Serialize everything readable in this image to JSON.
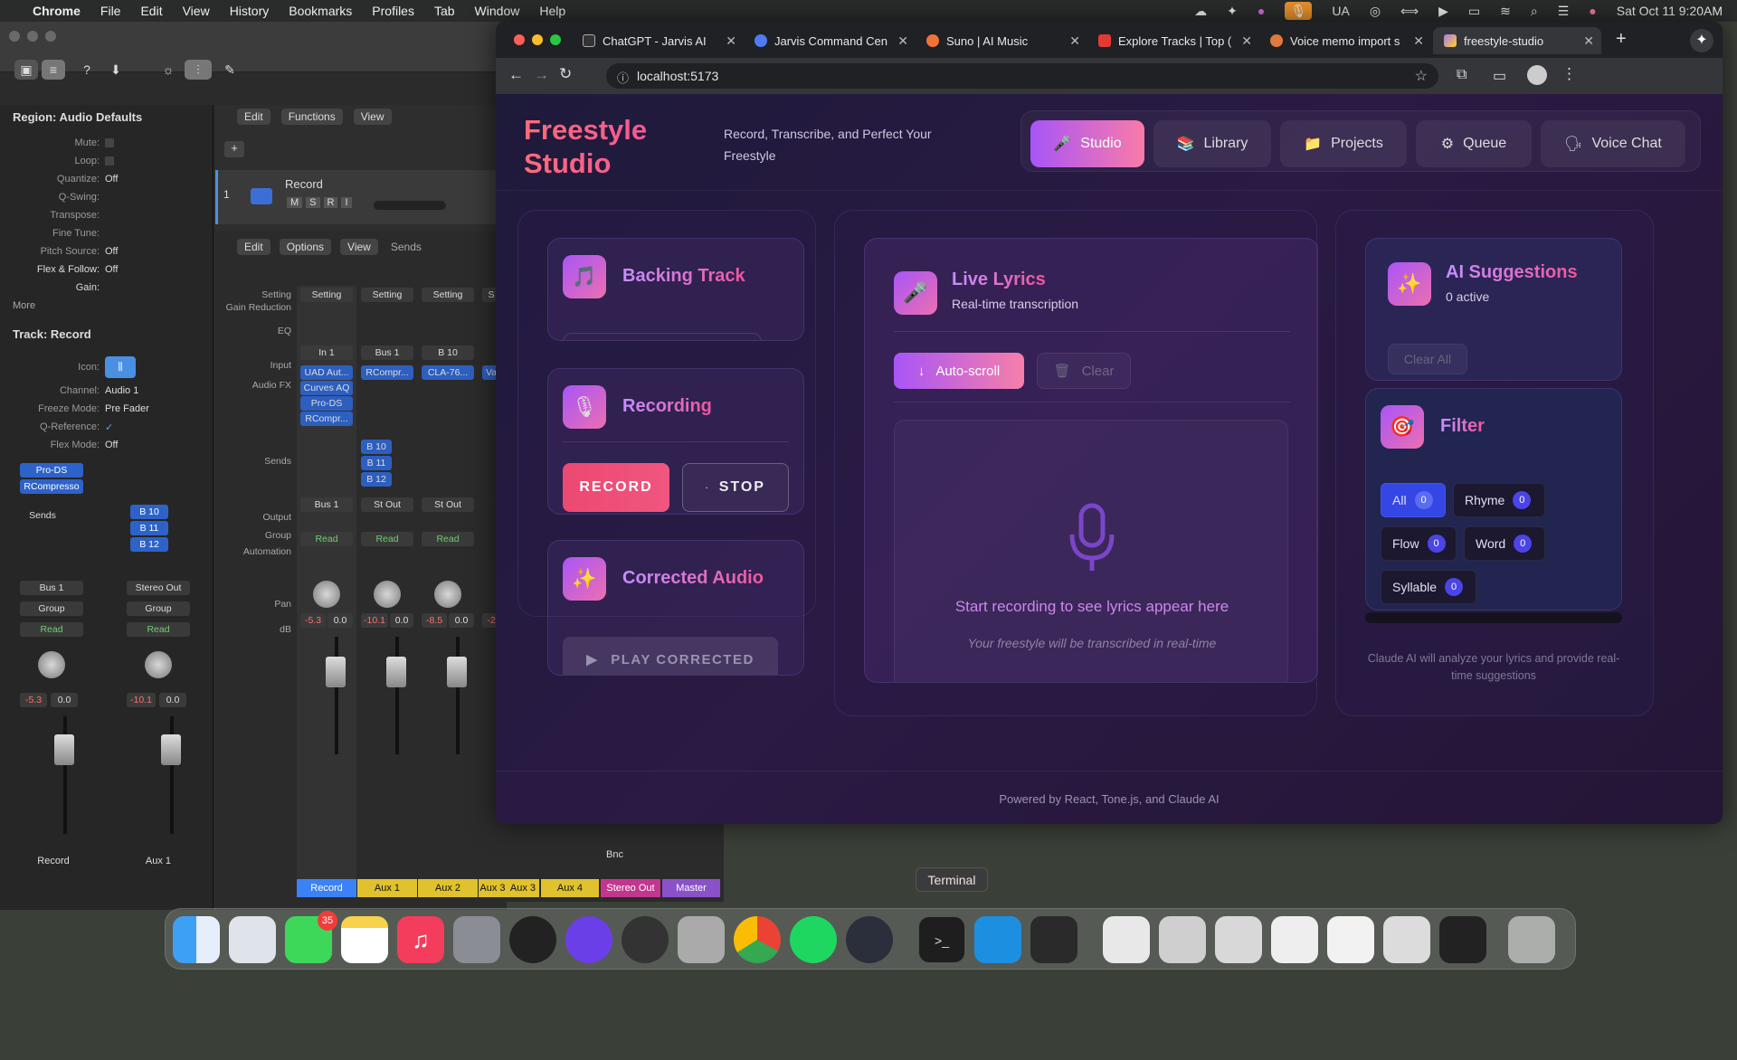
{
  "menubar": {
    "app": "Chrome",
    "items": [
      "File",
      "Edit",
      "View",
      "History",
      "Bookmarks",
      "Profiles",
      "Tab",
      "Window",
      "Help"
    ],
    "status_text": "UA",
    "datetime": "Sat Oct 11  9:20AM"
  },
  "logic": {
    "region_header": "Region: Audio Defaults",
    "region_rows": [
      {
        "k": "Mute:",
        "v": ""
      },
      {
        "k": "Loop:",
        "v": ""
      },
      {
        "k": "Quantize:",
        "v": "Off"
      },
      {
        "k": "Q-Swing:",
        "v": ""
      },
      {
        "k": "Transpose:",
        "v": ""
      },
      {
        "k": "Fine Tune:",
        "v": ""
      },
      {
        "k": "Pitch Source:",
        "v": "Off"
      },
      {
        "k": "Flex & Follow:",
        "v": "Off"
      },
      {
        "k": "Gain:",
        "v": ""
      }
    ],
    "more": "More",
    "track_header": "Track:  Record",
    "track_rows": [
      {
        "k": "Icon:",
        "v": ""
      },
      {
        "k": "Channel:",
        "v": "Audio 1"
      },
      {
        "k": "Freeze Mode:",
        "v": "Pre Fader"
      },
      {
        "k": "Q-Reference:",
        "v": "✓"
      },
      {
        "k": "Flex Mode:",
        "v": "Off"
      }
    ],
    "menus_top": [
      "Edit",
      "Functions",
      "View"
    ],
    "menus_mixer": [
      "Edit",
      "Options",
      "View",
      "Sends"
    ],
    "track_name": "Record",
    "track_buttons": [
      "M",
      "S",
      "R",
      "I"
    ],
    "row_labels": [
      "Setting",
      "Gain Reduction",
      "EQ",
      "Input",
      "Audio FX",
      "Sends",
      "Output",
      "Group",
      "Automation",
      "Pan",
      "dB"
    ],
    "strips": [
      {
        "setting": "Setting",
        "input": "In 1",
        "fx": [
          "UAD Aut...",
          "Curves AQ",
          "Pro-DS",
          "RCompr..."
        ],
        "sends": [],
        "output": "Bus 1",
        "auto": "Read",
        "db": [
          "-5.3",
          "0.0"
        ],
        "name": "Record",
        "color": "#3b82f6"
      },
      {
        "setting": "Setting",
        "input": "Bus 1",
        "fx": [
          "RCompr..."
        ],
        "sends": [
          "B 10",
          "B 11",
          "B 12"
        ],
        "output": "St Out",
        "auto": "Read",
        "db": [
          "-10.1",
          "0.0"
        ],
        "name": "Aux 1",
        "color": "#e6c530"
      },
      {
        "setting": "Setting",
        "input": "B 10",
        "fx": [
          "CLA-76..."
        ],
        "sends": [],
        "output": "St Out",
        "auto": "Read",
        "db": [
          "-8.5",
          "0.0"
        ],
        "name": "Aux 2",
        "color": "#e6c530"
      },
      {
        "setting": "S",
        "input": "",
        "fx": [
          "Va"
        ],
        "sends": [],
        "output": "",
        "auto": "",
        "db": [
          "-2",
          ""
        ],
        "name": "Aux 3",
        "color": "#e6c530"
      }
    ],
    "left_strips": [
      {
        "fx": [
          "Pro-DS",
          "RCompresso"
        ],
        "sends": [
          "Sends"
        ],
        "output": "Bus 1",
        "group": "Group",
        "auto": "Read",
        "db": [
          "-5.3",
          "0.0"
        ],
        "name": "Record"
      },
      {
        "fx": [],
        "sends": [
          "B 10",
          "B 11",
          "B 12"
        ],
        "output": "Stereo Out",
        "group": "Group",
        "auto": "Read",
        "db": [
          "-10.1",
          "0.0"
        ],
        "name": "Aux 1"
      }
    ],
    "bottom_labels": [
      "Record",
      "Aux 1",
      "Aux 2",
      "Aux 3",
      "Aux 4",
      "Stereo Out",
      "Master"
    ],
    "bnc": "Bnc"
  },
  "chrome": {
    "tabs": [
      {
        "title": "ChatGPT - Jarvis AI",
        "color": "#ffffff"
      },
      {
        "title": "Jarvis Command Cen",
        "color": "#4f7cf5"
      },
      {
        "title": "Suno | AI Music",
        "color": "#f0733a"
      },
      {
        "title": "Explore Tracks | Top (",
        "color": "#e53935"
      },
      {
        "title": "Voice memo import s",
        "color": "#e07a3a"
      },
      {
        "title": "freestyle-studio",
        "color": "#a879f0"
      }
    ],
    "url": "localhost:5173"
  },
  "app": {
    "brand": "Freestyle Studio",
    "tagline": "Record, Transcribe, and Perfect Your Freestyle",
    "nav": [
      {
        "label": "Studio",
        "icon": "🎤"
      },
      {
        "label": "Library",
        "icon": "📚"
      },
      {
        "label": "Projects",
        "icon": "📁"
      },
      {
        "label": "Queue",
        "icon": "⚙"
      },
      {
        "label": "Voice Chat",
        "icon": "🗣"
      }
    ],
    "backing": {
      "title": "Backing Track",
      "icon": "🎵"
    },
    "recording": {
      "title": "Recording",
      "icon": "🎙",
      "record": "RECORD",
      "stop": "STOP"
    },
    "corrected": {
      "title": "Corrected Audio",
      "icon": "✨",
      "play": "PLAY CORRECTED"
    },
    "lyrics": {
      "title": "Live Lyrics",
      "subtitle": "Real-time transcription",
      "autoscroll": "Auto-scroll",
      "clear": "Clear",
      "empty_title": "Start recording to see lyrics appear here",
      "empty_sub": "Your freestyle will be transcribed in real-time"
    },
    "suggestions": {
      "title": "AI Suggestions",
      "count": "0 active",
      "clear_all": "Clear All",
      "icon": "✨"
    },
    "filter": {
      "title": "Filter",
      "icon": "🎯",
      "chips": [
        {
          "label": "All",
          "count": "0"
        },
        {
          "label": "Rhyme",
          "count": "0"
        },
        {
          "label": "Flow",
          "count": "0"
        },
        {
          "label": "Word",
          "count": "0"
        },
        {
          "label": "Syllable",
          "count": "0"
        }
      ]
    },
    "claude_note": "Claude AI will analyze your lyrics and provide real-time suggestions",
    "footer": "Powered by React, Tone.js, and Claude AI"
  },
  "dock": {
    "tooltip": "Terminal",
    "badge": "35"
  }
}
